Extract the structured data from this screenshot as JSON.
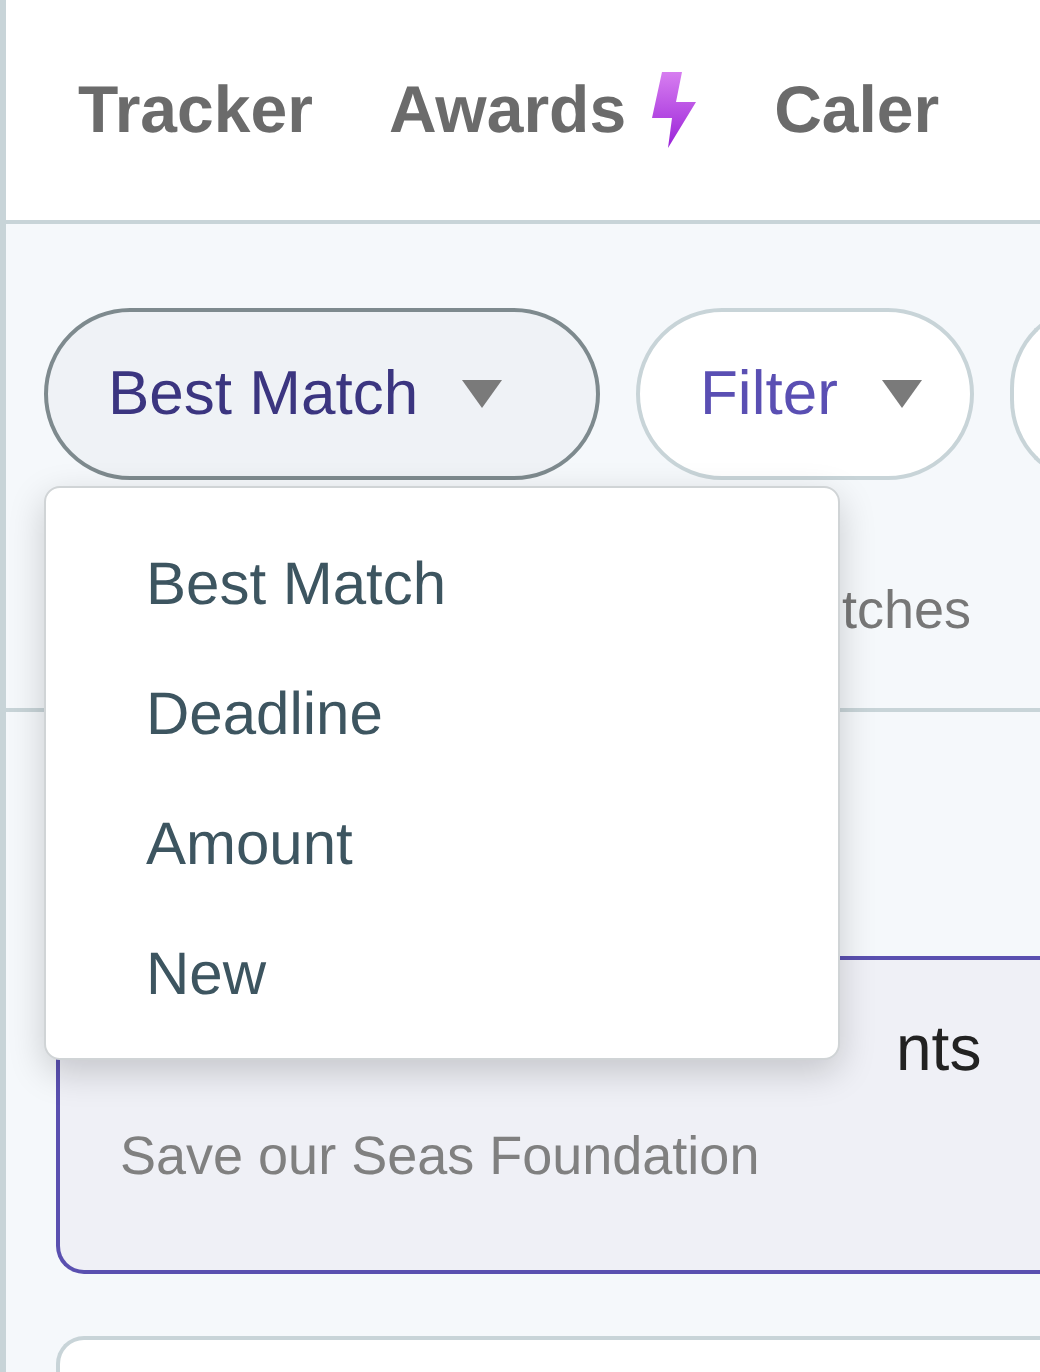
{
  "nav_tabs": [
    {
      "label": "Tracker",
      "kind": "plain"
    },
    {
      "label": "Awards",
      "kind": "bolt"
    },
    {
      "label": "Caler",
      "kind": "plain"
    }
  ],
  "toolbar": {
    "buttons": [
      {
        "label": "Best Match",
        "open": true
      },
      {
        "label": "Filter",
        "open": false
      }
    ]
  },
  "results_header": {
    "count_text": "tches"
  },
  "cards": [
    {
      "title": "nts",
      "funder": "Save our Seas Foundation",
      "selected": true
    },
    {
      "selected": false
    }
  ],
  "sort_menu": {
    "items": [
      "Best Match",
      "Deadline",
      "Amount",
      "New"
    ]
  }
}
